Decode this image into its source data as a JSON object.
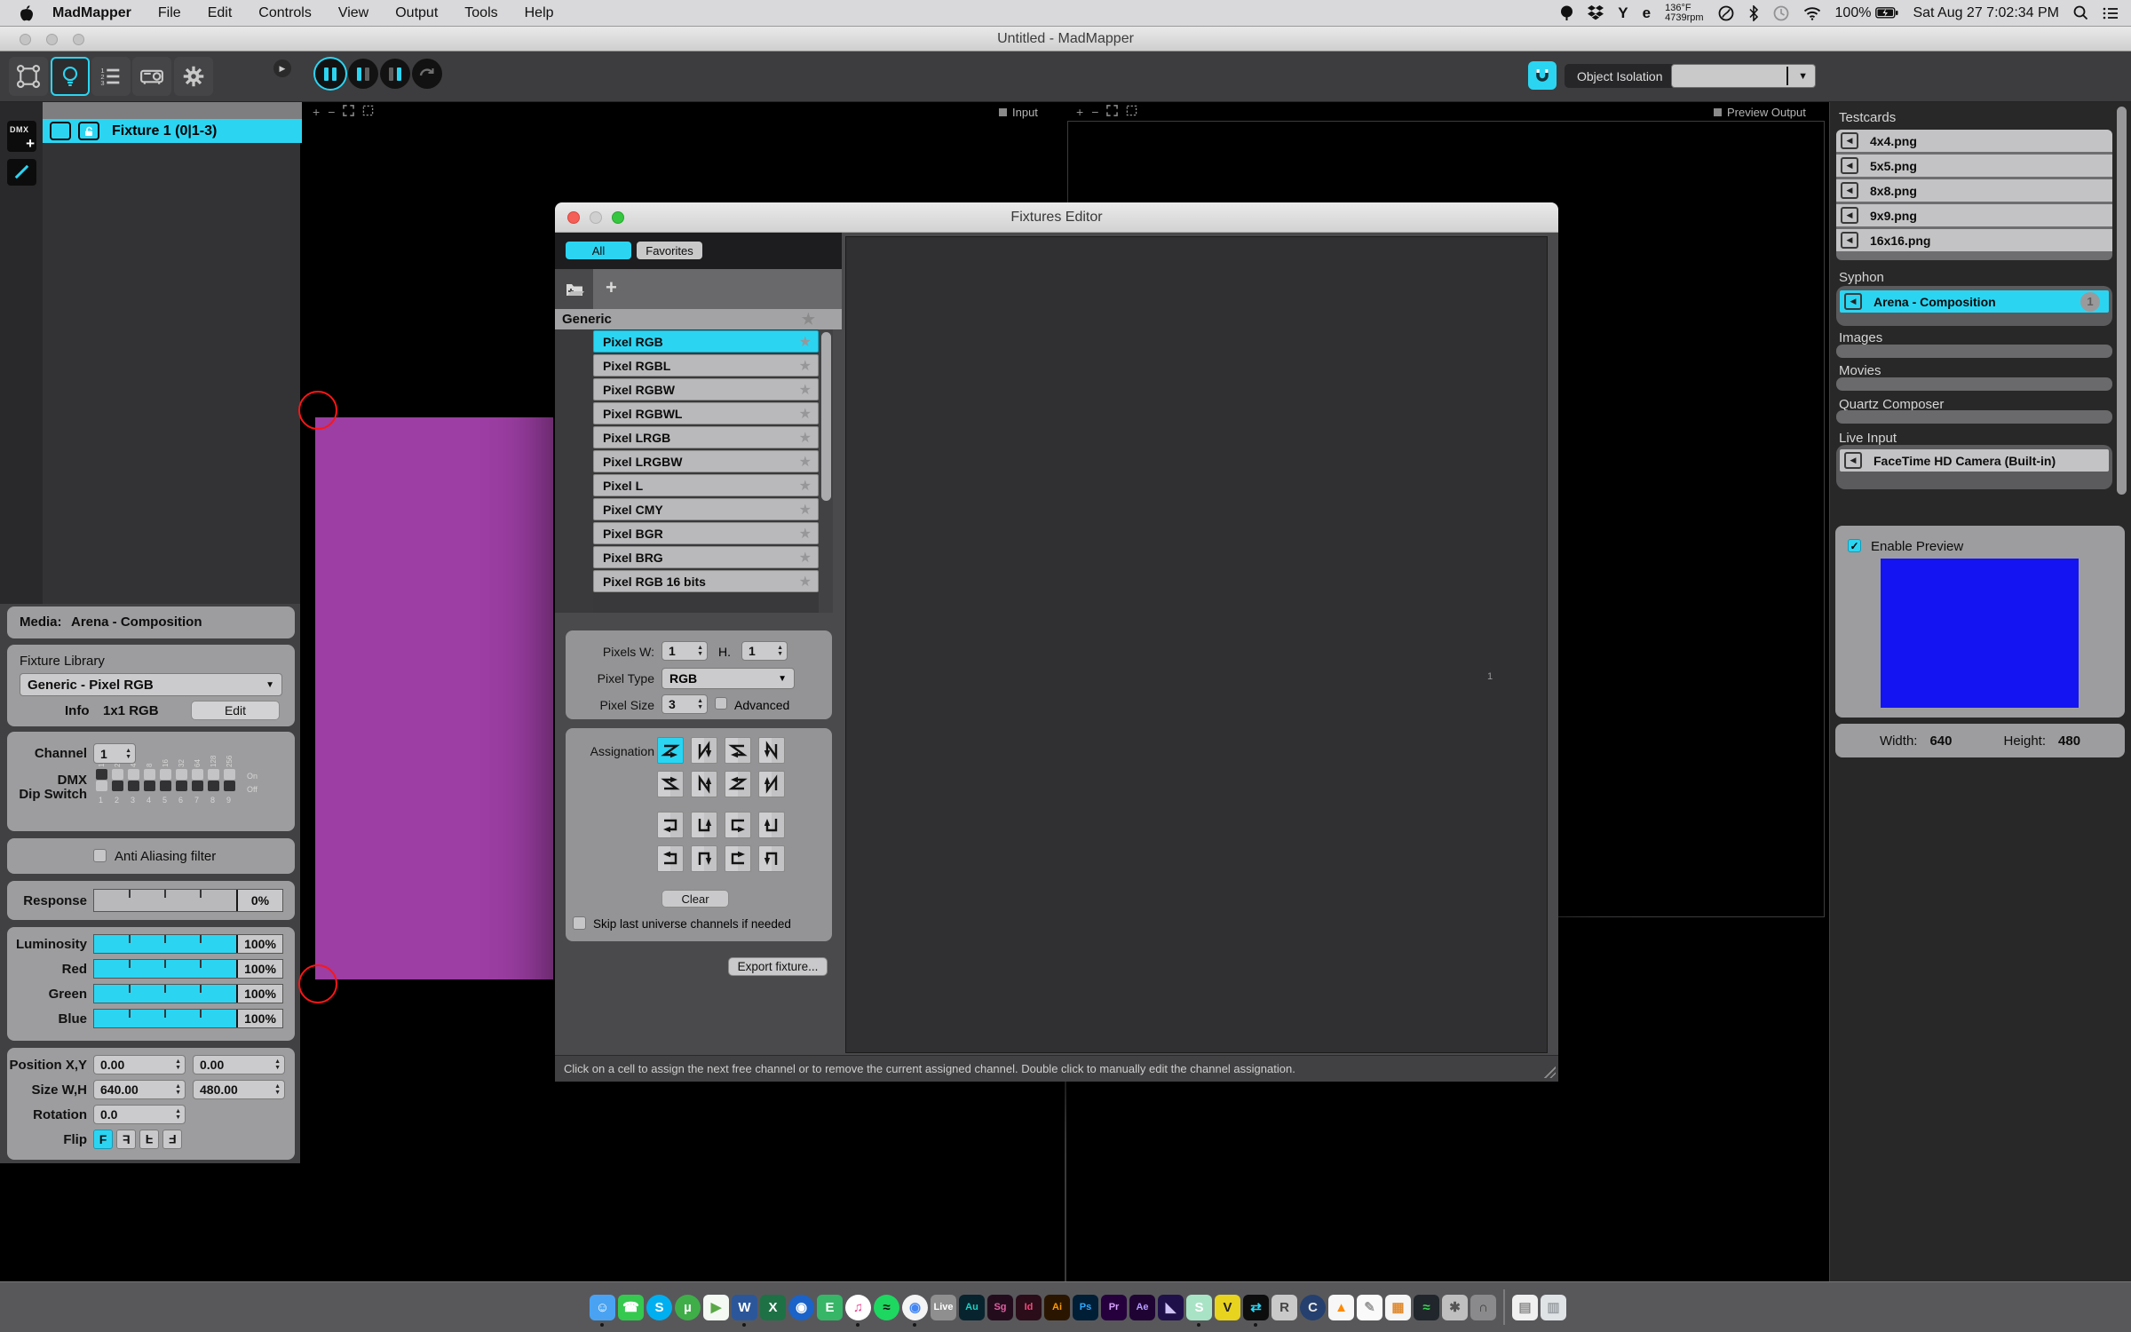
{
  "colors": {
    "accent": "#2bd5f2",
    "purple": "#9c3ea3",
    "preview_blue": "#1414f2"
  },
  "menu_bar": {
    "items": [
      "MadMapper",
      "File",
      "Edit",
      "Controls",
      "View",
      "Output",
      "Tools",
      "Help"
    ],
    "status": {
      "temp": "136°F",
      "fan": "4739rpm",
      "battery_pct": "100%",
      "clock": "Sat Aug 27 7:02:34 PM"
    }
  },
  "window": {
    "title": "Untitled - MadMapper"
  },
  "toolbar": {
    "object_isolation": "Object Isolation"
  },
  "canvas": {
    "input_label": "Input",
    "preview_output_label": "Preview Output"
  },
  "fixtures_panel": {
    "dmx_add": "DMX",
    "fixture_row": "Fixture 1 (0|1-3)"
  },
  "properties": {
    "media_label": "Media:",
    "media_value": "Arena - Composition",
    "fixture_library_title": "Fixture Library",
    "library_value": "Generic - Pixel RGB",
    "info_label": "Info",
    "info_value": "1x1 RGB",
    "edit_label": "Edit",
    "channel_label": "Channel",
    "channel_value": "1",
    "dmx_label_1": "DMX",
    "dmx_label_2": "Dip Switch",
    "dip_top": [
      "1",
      "2",
      "4",
      "8",
      "16",
      "32",
      "64",
      "128",
      "256"
    ],
    "dip_bottom": [
      "1",
      "2",
      "3",
      "4",
      "5",
      "6",
      "7",
      "8",
      "9"
    ],
    "dip_states": [
      true,
      false,
      false,
      false,
      false,
      false,
      false,
      false,
      false
    ],
    "dip_on": "On",
    "dip_off": "Off",
    "anti_aliasing": "Anti Aliasing filter",
    "response_label": "Response",
    "response_value": "0%",
    "sliders": [
      {
        "label": "Luminosity",
        "value": "100%"
      },
      {
        "label": "Red",
        "value": "100%"
      },
      {
        "label": "Green",
        "value": "100%"
      },
      {
        "label": "Blue",
        "value": "100%"
      }
    ],
    "position_label": "Position X,Y",
    "position_x": "0.00",
    "position_y": "0.00",
    "size_label": "Size W,H",
    "size_w": "640.00",
    "size_h": "480.00",
    "rotation_label": "Rotation",
    "rotation_value": "0.0",
    "flip_label": "Flip",
    "flip_glyph": "F"
  },
  "fixtures_editor": {
    "title": "Fixtures Editor",
    "tabs": [
      "All",
      "Favorites"
    ],
    "group_header": "Generic",
    "fixture_types": [
      "Pixel RGB",
      "Pixel RGBL",
      "Pixel RGBW",
      "Pixel RGBWL",
      "Pixel LRGB",
      "Pixel LRGBW",
      "Pixel L",
      "Pixel CMY",
      "Pixel BGR",
      "Pixel BRG",
      "Pixel RGB 16 bits"
    ],
    "selected_type": "Pixel RGB",
    "pixels_w_label": "Pixels W:",
    "pixels_w": "1",
    "pixels_h_label": "H.",
    "pixels_h": "1",
    "pixel_type_label": "Pixel Type",
    "pixel_type": "RGB",
    "pixel_size_label": "Pixel Size",
    "pixel_size": "3",
    "advanced_label": "Advanced",
    "assignation_label": "Assignation",
    "assignation_patterns": [
      "scan-z-right-down",
      "scan-n-down-right",
      "scan-z-left-down",
      "scan-n-down-left",
      "scan-z-right-up",
      "scan-n-up-right",
      "scan-z-left-up",
      "scan-n-up-left",
      "snake-right-down",
      "snake-down-right",
      "snake-left-down",
      "snake-down-left",
      "snake-right-up",
      "snake-up-right",
      "snake-left-up",
      "snake-up-left"
    ],
    "assignation_selected": 0,
    "clear_label": "Clear",
    "skip_label": "Skip last universe channels if needed",
    "export_label": "Export fixture...",
    "grid_cell_number": "1",
    "status_text": "Click on a cell to assign the next free channel or to remove the current assigned channel. Double click to manually edit the channel assignation."
  },
  "media_panel": {
    "testcards_title": "Testcards",
    "testcards": [
      "4x4.png",
      "5x5.png",
      "8x8.png",
      "9x9.png",
      "16x16.png"
    ],
    "syphon_title": "Syphon",
    "syphon_item": "Arena - Composition",
    "syphon_badge": "1",
    "images_title": "Images",
    "movies_title": "Movies",
    "quartz_title": "Quartz Composer",
    "live_input_title": "Live Input",
    "live_input_item": "FaceTime HD Camera (Built-in)",
    "enable_preview": "Enable Preview",
    "width_label": "Width:",
    "width_value": "640",
    "height_label": "Height:",
    "height_value": "480"
  },
  "dock": {
    "items": [
      {
        "name": "finder",
        "glyph": "☺",
        "bg": "#4aa3f2",
        "fg": "#ffffff",
        "running": true
      },
      {
        "name": "facetime",
        "glyph": "☎",
        "bg": "#35c94f",
        "fg": "#ffffff"
      },
      {
        "name": "skype",
        "glyph": "S",
        "bg": "#00aff0",
        "fg": "#ffffff",
        "shape": "circle"
      },
      {
        "name": "utorrent",
        "glyph": "µ",
        "bg": "#3fae49",
        "fg": "#ffffff",
        "shape": "circle"
      },
      {
        "name": "telegram",
        "glyph": "▶",
        "bg": "#f4f9f4",
        "fg": "#58a846"
      },
      {
        "name": "word",
        "glyph": "W",
        "bg": "#2b579a",
        "fg": "#ffffff",
        "running": true
      },
      {
        "name": "excel",
        "glyph": "X",
        "bg": "#1e7145",
        "fg": "#ffffff"
      },
      {
        "name": "network-sphere",
        "glyph": "◉",
        "bg": "#1b63c8",
        "fg": "#ffffff",
        "shape": "circle"
      },
      {
        "name": "evernote",
        "glyph": "E",
        "bg": "#37b667",
        "fg": "#ffffff"
      },
      {
        "name": "itunes",
        "glyph": "♫",
        "bg": "#ffffff",
        "fg": "#e83e8c",
        "shape": "circle",
        "running": true
      },
      {
        "name": "spotify",
        "glyph": "≈",
        "bg": "#1ed760",
        "fg": "#111111",
        "shape": "circle"
      },
      {
        "name": "chrome",
        "glyph": "◉",
        "bg": "#f4f4f4",
        "fg": "#4285f4",
        "shape": "circle",
        "running": true
      },
      {
        "name": "ableton-live",
        "glyph": "Live",
        "bg": "#8f8f90",
        "fg": "#ffffff",
        "small": true
      },
      {
        "name": "audition",
        "glyph": "Au",
        "bg": "#07232e",
        "fg": "#1ad1c2",
        "small": true
      },
      {
        "name": "speedgrade",
        "glyph": "Sg",
        "bg": "#230d1d",
        "fg": "#e05fa0",
        "small": true
      },
      {
        "name": "indesign",
        "glyph": "Id",
        "bg": "#2a0d18",
        "fg": "#f5477d",
        "small": true
      },
      {
        "name": "illustrator",
        "glyph": "Ai",
        "bg": "#2a1600",
        "fg": "#ff9a00",
        "small": true
      },
      {
        "name": "photoshop",
        "glyph": "Ps",
        "bg": "#001e36",
        "fg": "#31a8ff",
        "small": true
      },
      {
        "name": "premiere",
        "glyph": "Pr",
        "bg": "#25003d",
        "fg": "#d8a1ff",
        "small": true
      },
      {
        "name": "after-effects",
        "glyph": "Ae",
        "bg": "#1f0333",
        "fg": "#b49bff",
        "small": true
      },
      {
        "name": "media-encoder",
        "glyph": "◣",
        "bg": "#20104a",
        "fg": "#cfc3f5"
      },
      {
        "name": "mint-s-app",
        "glyph": "S",
        "bg": "#a9e3c6",
        "fg": "#ffffff",
        "running": true
      },
      {
        "name": "vdmx",
        "glyph": "V",
        "bg": "#e8d31f",
        "fg": "#222222"
      },
      {
        "name": "madmapper",
        "glyph": "⇄",
        "bg": "#0d0d0d",
        "fg": "#2bd5f2",
        "running": true
      },
      {
        "name": "rhino",
        "glyph": "R",
        "bg": "#c9c9c9",
        "fg": "#444444"
      },
      {
        "name": "cinema4d",
        "glyph": "C",
        "bg": "#25406e",
        "fg": "#e8e8e8",
        "shape": "circle"
      },
      {
        "name": "vlc",
        "glyph": "▲",
        "bg": "#f7f7f7",
        "fg": "#ff8a00"
      },
      {
        "name": "notes",
        "glyph": "✎",
        "bg": "#fafafa",
        "fg": "#999999"
      },
      {
        "name": "calculator",
        "glyph": "▦",
        "bg": "#f5f5f5",
        "fg": "#e08a2e"
      },
      {
        "name": "activity-monitor",
        "glyph": "≈",
        "bg": "#20262b",
        "fg": "#39d353"
      },
      {
        "name": "gears-app",
        "glyph": "✱",
        "bg": "#bfbfbf",
        "fg": "#555555"
      },
      {
        "name": "game-controller",
        "glyph": "∩",
        "bg": "#8a8a8c",
        "fg": "#3a3a3a"
      },
      {
        "name": "divider"
      },
      {
        "name": "documents-stack",
        "glyph": "▤",
        "bg": "#f0f0f0",
        "fg": "#8a8a8a"
      },
      {
        "name": "trash",
        "glyph": "▥",
        "bg": "#dfe3e6",
        "fg": "#9aa0a5"
      }
    ]
  }
}
